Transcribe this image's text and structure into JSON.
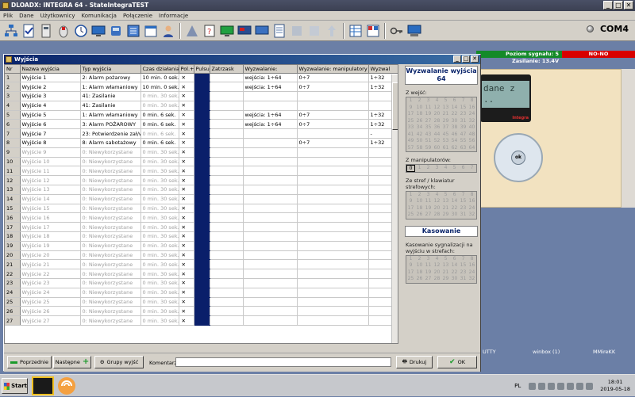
{
  "app": {
    "title": "DLOADX: INTEGRA 64 - StateIntegraTEST",
    "menu": [
      "Plik",
      "Dane",
      "Użytkownicy",
      "Komunikacja",
      "Połączenie",
      "Informacje"
    ],
    "com_port": "COM4"
  },
  "background_status": {
    "signal": "Poziom sygnału: 5   Zasilanie: 13.4V",
    "nono": "NO-NO"
  },
  "keypad": {
    "lcd_line1": "dane z",
    "lcd_line2": "..",
    "brand": "Integra",
    "ok": "ok"
  },
  "desktop": {
    "label1": "UTTY",
    "label2": "winbox (1)",
    "label3": "MMireKK"
  },
  "window": {
    "title": "Wyjścia",
    "columns": [
      "Nr",
      "Nazwa wyjścia",
      "Typ wyjścia",
      "Czas działania",
      "Pol.+",
      "Pulsuj.",
      "Zatrzask",
      "Wyzwalanie:",
      "Wyzwalanie: manipulatory",
      "Wyzwal"
    ],
    "rows": [
      {
        "nr": "1",
        "name": "Wyjście  1",
        "type": "2: Alarm pożarowy",
        "time": "10 min. 0  sek.",
        "pol": "✕",
        "trig": "wejścia: 1÷64",
        "man": "0÷7",
        "trig2": "1÷32",
        "dim": false
      },
      {
        "nr": "2",
        "name": "Wyjście  2",
        "type": "1: Alarm włamaniowy",
        "time": "10 min. 0  sek.",
        "pol": "✕",
        "trig": "wejścia: 1÷64",
        "man": "0÷7",
        "trig2": "1÷32",
        "dim": false
      },
      {
        "nr": "3",
        "name": "Wyjście  3",
        "type": "41: Zasilanie",
        "time": "0  min. 30 sek.",
        "pol": "✕",
        "trig": "",
        "man": "",
        "trig2": "",
        "dim": false,
        "dimtime": true
      },
      {
        "nr": "4",
        "name": "Wyjście  4",
        "type": "41: Zasilanie",
        "time": "0  min. 30 sek.",
        "pol": "✕",
        "trig": "",
        "man": "",
        "trig2": "",
        "dim": false,
        "dimtime": true
      },
      {
        "nr": "5",
        "name": "Wyjście  5",
        "type": "1: Alarm włamaniowy",
        "time": "0  min. 6  sek.",
        "pol": "✕",
        "trig": "wejścia: 1÷64",
        "man": "0÷7",
        "trig2": "1÷32",
        "dim": false
      },
      {
        "nr": "6",
        "name": "Wyjście  6",
        "type": "3: Alarm POŻAROWY",
        "time": "0  min. 6  sek.",
        "pol": "✕",
        "trig": "wejścia: 1÷64",
        "man": "0÷7",
        "trig2": "1÷32",
        "dim": false
      },
      {
        "nr": "7",
        "name": "Wyjście  7",
        "type": "23: Potwierdzenie zał/wył",
        "time": "0  min. 6  sek.",
        "pol": "✕",
        "trig": "",
        "man": "",
        "trig2": "-",
        "dim": false,
        "dimtime": true
      },
      {
        "nr": "8",
        "name": "Wyjście  8",
        "type": "8: Alarm sabotażowy",
        "time": "0  min. 6  sek.",
        "pol": "✕",
        "trig": "",
        "man": "0÷7",
        "trig2": "1÷32",
        "dim": false
      },
      {
        "nr": "9",
        "name": "Wyjście  9",
        "type": "0: Niewykorzystane",
        "time": "0  min. 30 sek.",
        "pol": "✕",
        "trig": "",
        "man": "",
        "trig2": "",
        "dim": true
      },
      {
        "nr": "10",
        "name": "Wyjście  10",
        "type": "0: Niewykorzystane",
        "time": "0  min. 30 sek.",
        "pol": "✕",
        "trig": "",
        "man": "",
        "trig2": "",
        "dim": true
      },
      {
        "nr": "11",
        "name": "Wyjście  11",
        "type": "0: Niewykorzystane",
        "time": "0  min. 30 sek.",
        "pol": "✕",
        "trig": "",
        "man": "",
        "trig2": "",
        "dim": true
      },
      {
        "nr": "12",
        "name": "Wyjście  12",
        "type": "0: Niewykorzystane",
        "time": "0  min. 30 sek.",
        "pol": "✕",
        "trig": "",
        "man": "",
        "trig2": "",
        "dim": true
      },
      {
        "nr": "13",
        "name": "Wyjście  13",
        "type": "0: Niewykorzystane",
        "time": "0  min. 30 sek.",
        "pol": "✕",
        "trig": "",
        "man": "",
        "trig2": "",
        "dim": true
      },
      {
        "nr": "14",
        "name": "Wyjście  14",
        "type": "0: Niewykorzystane",
        "time": "0  min. 30 sek.",
        "pol": "✕",
        "trig": "",
        "man": "",
        "trig2": "",
        "dim": true
      },
      {
        "nr": "15",
        "name": "Wyjście  15",
        "type": "0: Niewykorzystane",
        "time": "0  min. 30 sek.",
        "pol": "✕",
        "trig": "",
        "man": "",
        "trig2": "",
        "dim": true
      },
      {
        "nr": "16",
        "name": "Wyjście  16",
        "type": "0: Niewykorzystane",
        "time": "0  min. 30 sek.",
        "pol": "✕",
        "trig": "",
        "man": "",
        "trig2": "",
        "dim": true
      },
      {
        "nr": "17",
        "name": "Wyjście  17",
        "type": "0: Niewykorzystane",
        "time": "0  min. 30 sek.",
        "pol": "✕",
        "trig": "",
        "man": "",
        "trig2": "",
        "dim": true
      },
      {
        "nr": "18",
        "name": "Wyjście  18",
        "type": "0: Niewykorzystane",
        "time": "0  min. 30 sek.",
        "pol": "✕",
        "trig": "",
        "man": "",
        "trig2": "",
        "dim": true
      },
      {
        "nr": "19",
        "name": "Wyjście  19",
        "type": "0: Niewykorzystane",
        "time": "0  min. 30 sek.",
        "pol": "✕",
        "trig": "",
        "man": "",
        "trig2": "",
        "dim": true
      },
      {
        "nr": "20",
        "name": "Wyjście  20",
        "type": "0: Niewykorzystane",
        "time": "0  min. 30 sek.",
        "pol": "✕",
        "trig": "",
        "man": "",
        "trig2": "",
        "dim": true
      },
      {
        "nr": "21",
        "name": "Wyjście  21",
        "type": "0: Niewykorzystane",
        "time": "0  min. 30 sek.",
        "pol": "✕",
        "trig": "",
        "man": "",
        "trig2": "",
        "dim": true
      },
      {
        "nr": "22",
        "name": "Wyjście  22",
        "type": "0: Niewykorzystane",
        "time": "0  min. 30 sek.",
        "pol": "✕",
        "trig": "",
        "man": "",
        "trig2": "",
        "dim": true
      },
      {
        "nr": "23",
        "name": "Wyjście  23",
        "type": "0: Niewykorzystane",
        "time": "0  min. 30 sek.",
        "pol": "✕",
        "trig": "",
        "man": "",
        "trig2": "",
        "dim": true
      },
      {
        "nr": "24",
        "name": "Wyjście  24",
        "type": "0: Niewykorzystane",
        "time": "0  min. 30 sek.",
        "pol": "✕",
        "trig": "",
        "man": "",
        "trig2": "",
        "dim": true
      },
      {
        "nr": "25",
        "name": "Wyjście  25",
        "type": "0: Niewykorzystane",
        "time": "0  min. 30 sek.",
        "pol": "✕",
        "trig": "",
        "man": "",
        "trig2": "",
        "dim": true
      },
      {
        "nr": "26",
        "name": "Wyjście  26",
        "type": "0: Niewykorzystane",
        "time": "0  min. 30 sek.",
        "pol": "✕",
        "trig": "",
        "man": "",
        "trig2": "",
        "dim": true
      },
      {
        "nr": "27",
        "name": "Wyjście  27",
        "type": "0: Niewykorzystane",
        "time": "0  min. 30 sek.",
        "pol": "✕",
        "trig": "",
        "man": "",
        "trig2": "",
        "dim": true
      }
    ],
    "side": {
      "title": "Wyzwalanie wyjścia 64",
      "z_wejsc": "Z wejść:",
      "z_manipulatorow": "Z manipulatorów:",
      "ze_stref": "Ze stref / klawiatur strefowych:",
      "kasowanie_title": "Kasowanie",
      "kasowanie_desc": "Kasowanie sygnalizacji na wyjściu w strefach:"
    },
    "footer": {
      "prev": "Poprzednie",
      "next": "Następne",
      "groups": "Grupy wyjść",
      "comment_label": "Komentarz:",
      "comment_value": "",
      "print": "Drukuj",
      "ok": "OK"
    }
  },
  "taskbar": {
    "start": "Start",
    "lang": "PL",
    "time": "18:01",
    "date": "2019-05-18"
  },
  "colors": {
    "accent_blue": "#0a1f6a",
    "status_green": "#148a28",
    "alarm_red": "#d80000"
  }
}
